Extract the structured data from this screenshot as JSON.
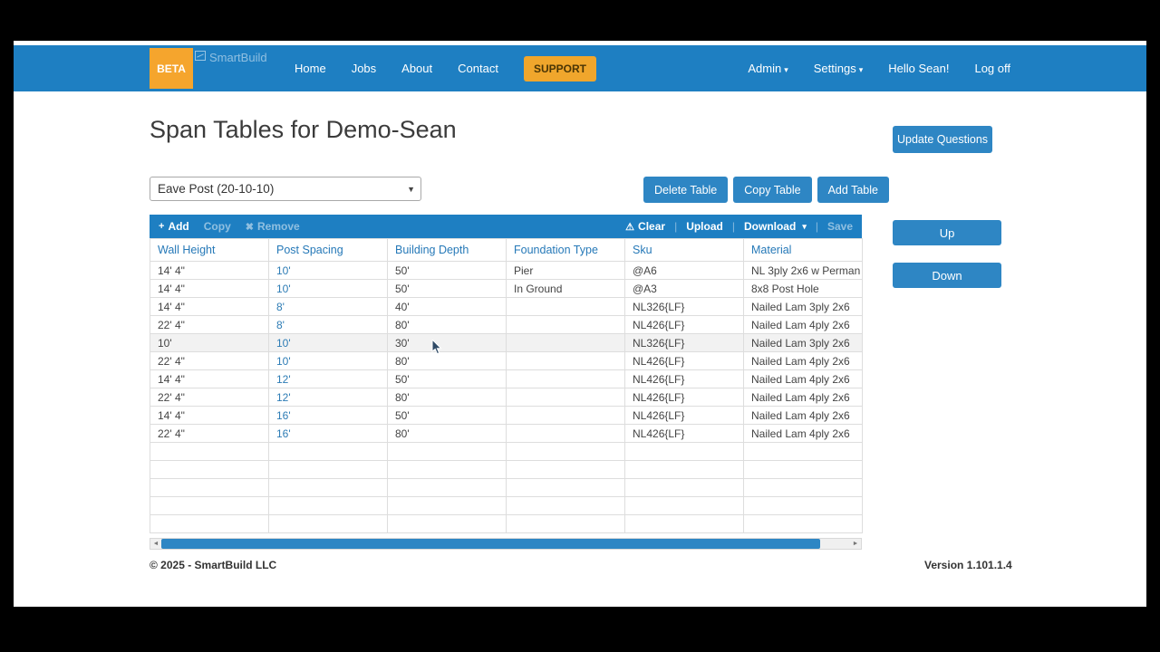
{
  "colors": {
    "navbar_blue": "#1e7fc2",
    "button_blue": "#2e86c4",
    "accent_orange": "#f0a62c",
    "header_text_blue": "#2679b8",
    "link_blue": "#2d7cb5"
  },
  "navbar": {
    "beta_badge": "BETA",
    "brand_alt_text": "SmartBuild",
    "links": [
      "Home",
      "Jobs",
      "About",
      "Contact"
    ],
    "support_label": "SUPPORT",
    "admin_label": "Admin",
    "settings_label": "Settings",
    "greeting": "Hello Sean!",
    "logoff_label": "Log off"
  },
  "page": {
    "title": "Span Tables for Demo-Sean",
    "update_questions_label": "Update Questions",
    "selected_table": "Eave Post (20-10-10)",
    "delete_table_label": "Delete Table",
    "copy_table_label": "Copy Table",
    "add_table_label": "Add Table",
    "up_label": "Up",
    "down_label": "Down"
  },
  "grid_toolbar": {
    "add_label": "Add",
    "copy_label": "Copy",
    "remove_label": "Remove",
    "clear_label": "Clear",
    "upload_label": "Upload",
    "download_label": "Download",
    "save_label": "Save"
  },
  "grid": {
    "columns": [
      "Wall Height",
      "Post Spacing",
      "Building Depth",
      "Foundation Type",
      "Sku",
      "Material"
    ],
    "rows": [
      [
        "14' 4\"",
        "10'",
        "50'",
        "Pier",
        "@A6",
        "NL 3ply 2x6 w Perman ..."
      ],
      [
        "14' 4\"",
        "10'",
        "50'",
        "In Ground",
        "@A3",
        "8x8 Post Hole"
      ],
      [
        "14' 4\"",
        "8'",
        "40'",
        "",
        "NL326{LF}",
        "Nailed Lam 3ply 2x6"
      ],
      [
        "22' 4\"",
        "8'",
        "80'",
        "",
        "NL426{LF}",
        "Nailed Lam 4ply 2x6"
      ],
      [
        "10'",
        "10'",
        "30'",
        "",
        "NL326{LF}",
        "Nailed Lam 3ply 2x6"
      ],
      [
        "22' 4\"",
        "10'",
        "80'",
        "",
        "NL426{LF}",
        "Nailed Lam 4ply 2x6"
      ],
      [
        "14' 4\"",
        "12'",
        "50'",
        "",
        "NL426{LF}",
        "Nailed Lam 4ply 2x6"
      ],
      [
        "22' 4\"",
        "12'",
        "80'",
        "",
        "NL426{LF}",
        "Nailed Lam 4ply 2x6"
      ],
      [
        "14' 4\"",
        "16'",
        "50'",
        "",
        "NL426{LF}",
        "Nailed Lam 4ply 2x6"
      ],
      [
        "22' 4\"",
        "16'",
        "80'",
        "",
        "NL426{LF}",
        "Nailed Lam 4ply 2x6"
      ]
    ],
    "highlighted_row": 4,
    "empty_rows": 5
  },
  "footer": {
    "copyright": "© 2025 - SmartBuild LLC",
    "version": "Version 1.101.1.4"
  }
}
